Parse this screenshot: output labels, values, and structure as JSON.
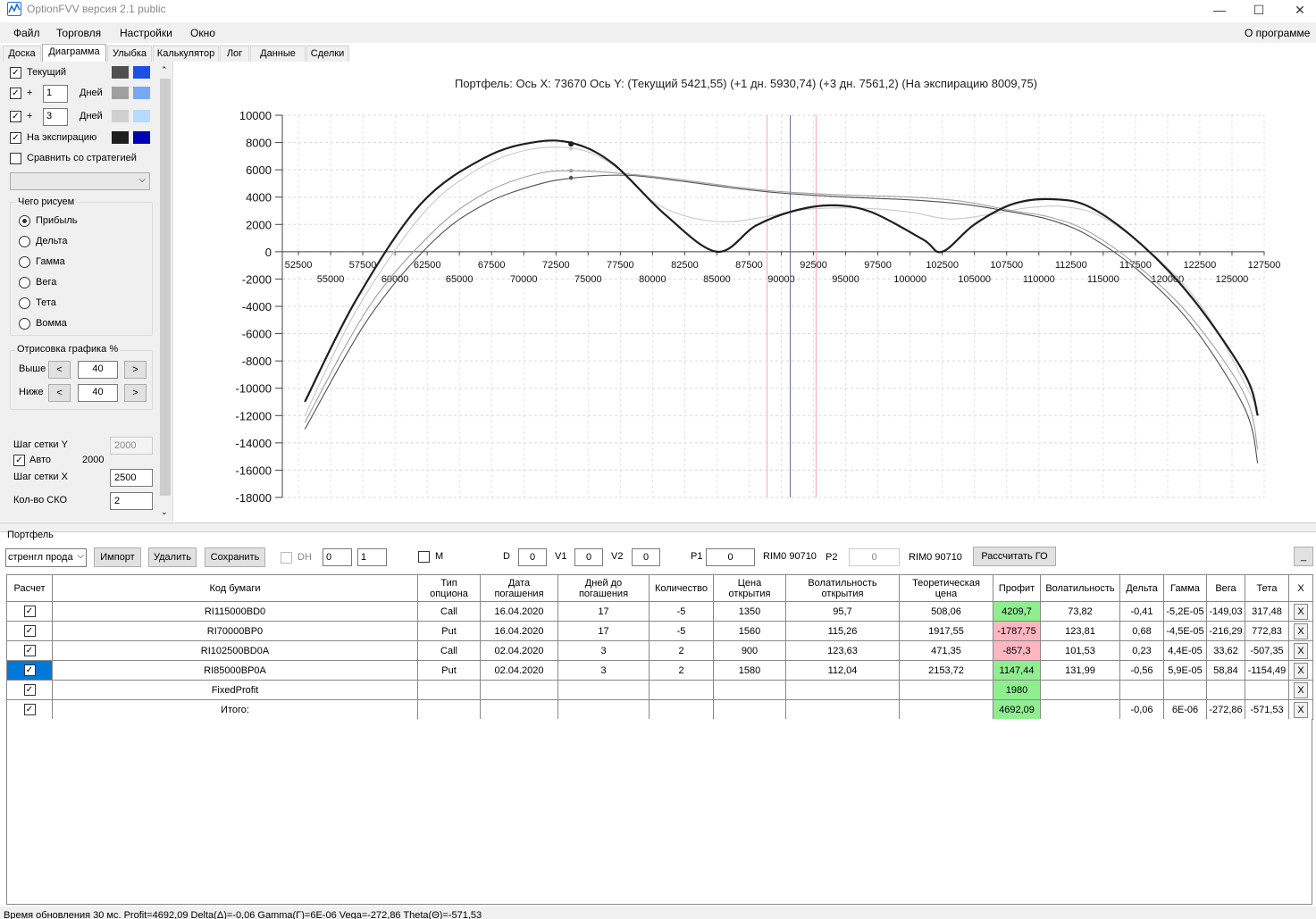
{
  "window": {
    "title": "OptionFVV версия 2.1 public",
    "min": "—",
    "max": "☐",
    "close": "✕"
  },
  "menu": {
    "file": "Файл",
    "trade": "Торговля",
    "settings": "Настройки",
    "window": "Окно",
    "about": "О программе"
  },
  "tabs": [
    "Доска",
    "Диаграмма",
    "Улыбка",
    "Калькулятор",
    "Лог",
    "Данные",
    "Сделки"
  ],
  "left": {
    "current": "Текущий",
    "plus": "+",
    "days_label": "Дней",
    "days1": "1",
    "days3": "3",
    "expiry": "На экспирацию",
    "compare": "Сравнить со стратегией",
    "what_title": "Чего рисуем",
    "radios": [
      "Прибыль",
      "Дельта",
      "Гамма",
      "Вега",
      "Тета",
      "Вомма"
    ],
    "draw_title": "Отрисовка графика %",
    "above": "Выше",
    "below": "Ниже",
    "above_val": "40",
    "below_val": "40",
    "lt": "<",
    "gt": ">",
    "grid_y": "Шаг сетки Y",
    "grid_y_val": "2000",
    "auto": "Авто",
    "auto_val": "2000",
    "grid_x": "Шаг сетки X",
    "grid_x_val": "2500",
    "sko": "Кол-во СКО",
    "sko_val": "2",
    "colors": {
      "current": [
        "#505050",
        "#1c4fe6"
      ],
      "d1": [
        "#a0a0a0",
        "#7aa7f5"
      ],
      "d3": [
        "#cfcfcf",
        "#b4dcff"
      ],
      "exp": [
        "#1e1e1e",
        "#0000b4"
      ]
    }
  },
  "chart_title": "Портфель: Ось X: 73670 Ось Y:  (Текущий 5421,55)  (+1 дн. 5930,74)  (+3 дн. 7561,2)  (На экспирацию 8009,75)",
  "chart_data": {
    "type": "line",
    "xlim": [
      51250,
      127500
    ],
    "ylim": [
      -18000,
      10000
    ],
    "x_ticks_top": [
      "52500",
      "57500",
      "62500",
      "67500",
      "72500",
      "77500",
      "82500",
      "87500",
      "92500",
      "97500",
      "102500",
      "107500",
      "112500",
      "117500",
      "122500",
      "127500"
    ],
    "x_ticks_bottom": [
      "55000",
      "60000",
      "65000",
      "70000",
      "75000",
      "80000",
      "85000",
      "90000",
      "95000",
      "100000",
      "105000",
      "110000",
      "115000",
      "120000",
      "125000"
    ],
    "y_ticks": [
      "10000",
      "8000",
      "6000",
      "4000",
      "2000",
      "0",
      "-2000",
      "-4000",
      "-6000",
      "-8000",
      "-10000",
      "-12000",
      "-14000",
      "-16000",
      "-18000"
    ],
    "markers": {
      "current_x": 73670,
      "red_lines": [
        88900,
        92700
      ],
      "blue_line": 90700
    },
    "series": [
      {
        "color": "#1e1e1e",
        "width": 2.2,
        "points": [
          [
            53000,
            -11000
          ],
          [
            57000,
            -3500
          ],
          [
            62000,
            3500
          ],
          [
            67000,
            6900
          ],
          [
            71000,
            8050
          ],
          [
            74000,
            7900
          ],
          [
            77000,
            6400
          ],
          [
            81000,
            2700
          ],
          [
            85000,
            0
          ],
          [
            88000,
            1900
          ],
          [
            91000,
            3000
          ],
          [
            94000,
            3400
          ],
          [
            97000,
            2900
          ],
          [
            101000,
            900
          ],
          [
            102500,
            0
          ],
          [
            105000,
            2000
          ],
          [
            108000,
            3500
          ],
          [
            111000,
            3850
          ],
          [
            114000,
            3250
          ],
          [
            118000,
            500
          ],
          [
            122000,
            -3500
          ],
          [
            126000,
            -9000
          ],
          [
            127000,
            -12000
          ]
        ]
      },
      {
        "color": "#505050",
        "width": 1.1,
        "points": [
          [
            53000,
            -13000
          ],
          [
            58000,
            -4800
          ],
          [
            63000,
            800
          ],
          [
            67000,
            3500
          ],
          [
            71000,
            4900
          ],
          [
            74000,
            5420
          ],
          [
            78000,
            5600
          ],
          [
            82000,
            5200
          ],
          [
            86000,
            4700
          ],
          [
            90000,
            4300
          ],
          [
            95000,
            4000
          ],
          [
            100000,
            3800
          ],
          [
            104000,
            3500
          ],
          [
            108000,
            2900
          ],
          [
            111000,
            2300
          ],
          [
            114000,
            1100
          ],
          [
            118000,
            -1600
          ],
          [
            122000,
            -5500
          ],
          [
            126000,
            -11500
          ],
          [
            127000,
            -15500
          ]
        ]
      },
      {
        "color": "#a0a0a0",
        "width": 1.1,
        "points": [
          [
            53000,
            -12500
          ],
          [
            58000,
            -4000
          ],
          [
            63000,
            1500
          ],
          [
            67000,
            4300
          ],
          [
            71000,
            5700
          ],
          [
            74000,
            5930
          ],
          [
            78000,
            5700
          ],
          [
            82000,
            5300
          ],
          [
            86000,
            4800
          ],
          [
            90000,
            4400
          ],
          [
            95000,
            4150
          ],
          [
            100000,
            4000
          ],
          [
            104000,
            3700
          ],
          [
            108000,
            3000
          ],
          [
            111000,
            2500
          ],
          [
            114000,
            1400
          ],
          [
            118000,
            -1300
          ],
          [
            122000,
            -5000
          ],
          [
            126000,
            -10500
          ],
          [
            127000,
            -14500
          ]
        ]
      },
      {
        "color": "#c8c8c8",
        "width": 1.1,
        "points": [
          [
            53000,
            -12000
          ],
          [
            57000,
            -4300
          ],
          [
            62000,
            2600
          ],
          [
            66000,
            5800
          ],
          [
            70000,
            7400
          ],
          [
            74000,
            7560
          ],
          [
            77000,
            6300
          ],
          [
            80000,
            3700
          ],
          [
            83000,
            2500
          ],
          [
            86000,
            2200
          ],
          [
            89000,
            2600
          ],
          [
            92000,
            3100
          ],
          [
            96000,
            3200
          ],
          [
            100000,
            2900
          ],
          [
            103000,
            2400
          ],
          [
            106000,
            2700
          ],
          [
            109000,
            3200
          ],
          [
            112000,
            3300
          ],
          [
            115000,
            2500
          ],
          [
            119000,
            -300
          ],
          [
            123000,
            -4500
          ],
          [
            127000,
            -11500
          ]
        ]
      }
    ]
  },
  "portfolio": {
    "title": "Портфель",
    "strategy": "стренгл прода",
    "import": "Импорт",
    "delete": "Удалить",
    "save": "Сохранить",
    "dh": "DH",
    "spin0": "0",
    "spin1": "1",
    "m": "M",
    "d_label": "D",
    "d_val": "0",
    "v1_label": "V1",
    "v1_val": "0",
    "v2_label": "V2",
    "v2_val": "0",
    "p1_label": "P1",
    "p1_val": "0",
    "rim1": "RIM0 90710",
    "p2_label": "P2",
    "p2_val": "0",
    "rim2": "RIM0 90710",
    "calc": "Рассчитать ГО",
    "minimize": "_"
  },
  "grid": {
    "headers": [
      "Расчет",
      "Код бумаги",
      "Тип\nопциона",
      "Дата\nпогашения",
      "Дней до\nпогашения",
      "Количество",
      "Цена\nоткрытия",
      "Волатильность\nоткрытия",
      "Теоретическая\nцена",
      "Профит",
      "Волатильность",
      "Дельта",
      "Гамма",
      "Вега",
      "Тета",
      "X"
    ],
    "rows": [
      {
        "code": "RI115000BD0",
        "type": "Call",
        "date": "16.04.2020",
        "days": "17",
        "qty": "-5",
        "price": "1350",
        "vol_open": "95,7",
        "theo": "508,06",
        "profit": "4209,7",
        "profit_sign": "pos",
        "vol": "73,82",
        "delta": "-0,41",
        "gamma": "-5,2E-05",
        "vega": "-149,03",
        "theta": "317,48"
      },
      {
        "code": "RI70000BP0",
        "type": "Put",
        "date": "16.04.2020",
        "days": "17",
        "qty": "-5",
        "price": "1560",
        "vol_open": "115,26",
        "theo": "1917,55",
        "profit": "-1787,75",
        "profit_sign": "neg",
        "vol": "123,81",
        "delta": "0,68",
        "gamma": "-4,5E-05",
        "vega": "-216,29",
        "theta": "772,83"
      },
      {
        "code": "RI102500BD0A",
        "type": "Call",
        "date": "02.04.2020",
        "days": "3",
        "qty": "2",
        "price": "900",
        "vol_open": "123,63",
        "theo": "471,35",
        "profit": "-857,3",
        "profit_sign": "neg",
        "vol": "101,53",
        "delta": "0,23",
        "gamma": "4,4E-05",
        "vega": "33,62",
        "theta": "-507,35"
      },
      {
        "code": "RI85000BP0A",
        "type": "Put",
        "date": "02.04.2020",
        "days": "3",
        "qty": "2",
        "price": "1580",
        "vol_open": "112,04",
        "theo": "2153,72",
        "profit": "1147,44",
        "profit_sign": "pos",
        "vol": "131,99",
        "delta": "-0,56",
        "gamma": "5,9E-05",
        "vega": "58,84",
        "theta": "-1154,49"
      },
      {
        "code": "FixedProfit",
        "type": "",
        "date": "",
        "days": "",
        "qty": "",
        "price": "",
        "vol_open": "",
        "theo": "",
        "profit": "1980",
        "profit_sign": "pos",
        "vol": "",
        "delta": "",
        "gamma": "",
        "vega": "",
        "theta": ""
      },
      {
        "code": "Итого:",
        "type": "",
        "date": "",
        "days": "",
        "qty": "",
        "price": "",
        "vol_open": "",
        "theo": "",
        "profit": "4692,09",
        "profit_sign": "pos",
        "vol": "",
        "delta": "-0,06",
        "gamma": "6E-06",
        "vega": "-272,86",
        "theta": "-571,53"
      }
    ],
    "x_label": "X",
    "check": "✓"
  },
  "status": "Время обновления 30 мс. Profit=4692,09 Delta(Δ)=-0,06 Gamma(Γ)=6E-06 Vega=-272,86 Theta(Θ)=-571,53"
}
